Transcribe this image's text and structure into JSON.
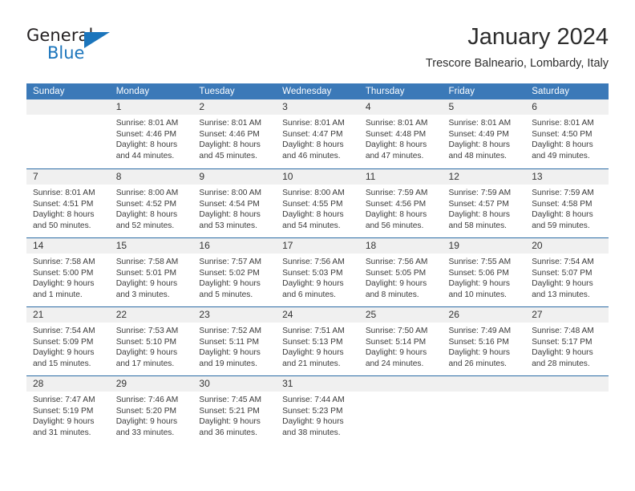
{
  "brand": {
    "name_part1": "General",
    "name_part2": "Blue",
    "flag_icon": "triangle-flag-icon",
    "accent_color": "#1b75bc"
  },
  "header": {
    "title": "January 2024",
    "subtitle": "Trescore Balneario, Lombardy, Italy"
  },
  "calendar": {
    "header_bg_color": "#3b79b8",
    "daynum_bg_color": "#f0f0f0",
    "week_border_color": "#2c6ca5",
    "weekdays": [
      "Sunday",
      "Monday",
      "Tuesday",
      "Wednesday",
      "Thursday",
      "Friday",
      "Saturday"
    ],
    "weeks": [
      [
        {
          "day": "",
          "text": ""
        },
        {
          "day": "1",
          "text": "Sunrise: 8:01 AM\nSunset: 4:46 PM\nDaylight: 8 hours\nand 44 minutes."
        },
        {
          "day": "2",
          "text": "Sunrise: 8:01 AM\nSunset: 4:46 PM\nDaylight: 8 hours\nand 45 minutes."
        },
        {
          "day": "3",
          "text": "Sunrise: 8:01 AM\nSunset: 4:47 PM\nDaylight: 8 hours\nand 46 minutes."
        },
        {
          "day": "4",
          "text": "Sunrise: 8:01 AM\nSunset: 4:48 PM\nDaylight: 8 hours\nand 47 minutes."
        },
        {
          "day": "5",
          "text": "Sunrise: 8:01 AM\nSunset: 4:49 PM\nDaylight: 8 hours\nand 48 minutes."
        },
        {
          "day": "6",
          "text": "Sunrise: 8:01 AM\nSunset: 4:50 PM\nDaylight: 8 hours\nand 49 minutes."
        }
      ],
      [
        {
          "day": "7",
          "text": "Sunrise: 8:01 AM\nSunset: 4:51 PM\nDaylight: 8 hours\nand 50 minutes."
        },
        {
          "day": "8",
          "text": "Sunrise: 8:00 AM\nSunset: 4:52 PM\nDaylight: 8 hours\nand 52 minutes."
        },
        {
          "day": "9",
          "text": "Sunrise: 8:00 AM\nSunset: 4:54 PM\nDaylight: 8 hours\nand 53 minutes."
        },
        {
          "day": "10",
          "text": "Sunrise: 8:00 AM\nSunset: 4:55 PM\nDaylight: 8 hours\nand 54 minutes."
        },
        {
          "day": "11",
          "text": "Sunrise: 7:59 AM\nSunset: 4:56 PM\nDaylight: 8 hours\nand 56 minutes."
        },
        {
          "day": "12",
          "text": "Sunrise: 7:59 AM\nSunset: 4:57 PM\nDaylight: 8 hours\nand 58 minutes."
        },
        {
          "day": "13",
          "text": "Sunrise: 7:59 AM\nSunset: 4:58 PM\nDaylight: 8 hours\nand 59 minutes."
        }
      ],
      [
        {
          "day": "14",
          "text": "Sunrise: 7:58 AM\nSunset: 5:00 PM\nDaylight: 9 hours\nand 1 minute."
        },
        {
          "day": "15",
          "text": "Sunrise: 7:58 AM\nSunset: 5:01 PM\nDaylight: 9 hours\nand 3 minutes."
        },
        {
          "day": "16",
          "text": "Sunrise: 7:57 AM\nSunset: 5:02 PM\nDaylight: 9 hours\nand 5 minutes."
        },
        {
          "day": "17",
          "text": "Sunrise: 7:56 AM\nSunset: 5:03 PM\nDaylight: 9 hours\nand 6 minutes."
        },
        {
          "day": "18",
          "text": "Sunrise: 7:56 AM\nSunset: 5:05 PM\nDaylight: 9 hours\nand 8 minutes."
        },
        {
          "day": "19",
          "text": "Sunrise: 7:55 AM\nSunset: 5:06 PM\nDaylight: 9 hours\nand 10 minutes."
        },
        {
          "day": "20",
          "text": "Sunrise: 7:54 AM\nSunset: 5:07 PM\nDaylight: 9 hours\nand 13 minutes."
        }
      ],
      [
        {
          "day": "21",
          "text": "Sunrise: 7:54 AM\nSunset: 5:09 PM\nDaylight: 9 hours\nand 15 minutes."
        },
        {
          "day": "22",
          "text": "Sunrise: 7:53 AM\nSunset: 5:10 PM\nDaylight: 9 hours\nand 17 minutes."
        },
        {
          "day": "23",
          "text": "Sunrise: 7:52 AM\nSunset: 5:11 PM\nDaylight: 9 hours\nand 19 minutes."
        },
        {
          "day": "24",
          "text": "Sunrise: 7:51 AM\nSunset: 5:13 PM\nDaylight: 9 hours\nand 21 minutes."
        },
        {
          "day": "25",
          "text": "Sunrise: 7:50 AM\nSunset: 5:14 PM\nDaylight: 9 hours\nand 24 minutes."
        },
        {
          "day": "26",
          "text": "Sunrise: 7:49 AM\nSunset: 5:16 PM\nDaylight: 9 hours\nand 26 minutes."
        },
        {
          "day": "27",
          "text": "Sunrise: 7:48 AM\nSunset: 5:17 PM\nDaylight: 9 hours\nand 28 minutes."
        }
      ],
      [
        {
          "day": "28",
          "text": "Sunrise: 7:47 AM\nSunset: 5:19 PM\nDaylight: 9 hours\nand 31 minutes."
        },
        {
          "day": "29",
          "text": "Sunrise: 7:46 AM\nSunset: 5:20 PM\nDaylight: 9 hours\nand 33 minutes."
        },
        {
          "day": "30",
          "text": "Sunrise: 7:45 AM\nSunset: 5:21 PM\nDaylight: 9 hours\nand 36 minutes."
        },
        {
          "day": "31",
          "text": "Sunrise: 7:44 AM\nSunset: 5:23 PM\nDaylight: 9 hours\nand 38 minutes."
        },
        {
          "day": "",
          "text": ""
        },
        {
          "day": "",
          "text": ""
        },
        {
          "day": "",
          "text": ""
        }
      ]
    ]
  }
}
